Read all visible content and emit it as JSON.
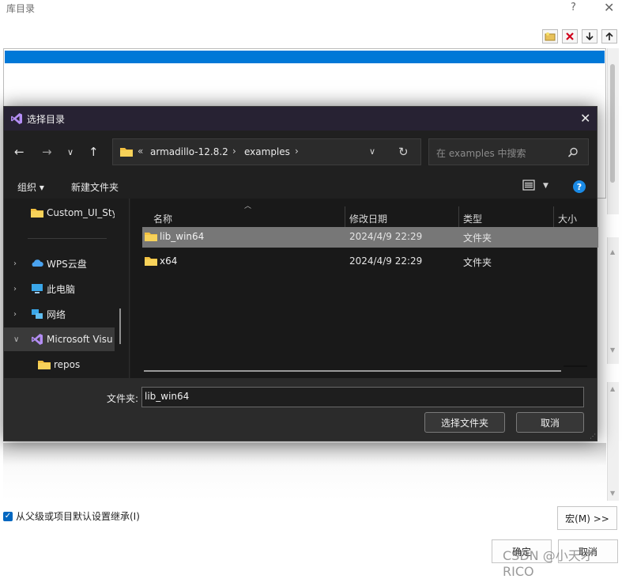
{
  "background_window": {
    "title": "库目录",
    "help": "?",
    "close": "✕",
    "inherit_label": "从父级或项目默认设置继承(I)",
    "macro_button": "宏(M) >>",
    "ok_button": "确定",
    "cancel_button": "取消",
    "watermark": "CSDN @小天才RICO"
  },
  "dialog": {
    "title": "选择目录",
    "close": "✕",
    "breadcrumb": {
      "overflow": "«",
      "parts": [
        "armadillo-12.8.2",
        "examples"
      ]
    },
    "search_placeholder": "在 examples 中搜索",
    "toolbar": {
      "organize": "组织 ▾",
      "new_folder": "新建文件夹",
      "help": "?"
    },
    "nav": [
      {
        "label": "Custom_UI_Sty",
        "icon": "folder-icon",
        "expandable": false
      },
      {
        "label": "WPS云盘",
        "icon": "cloud-icon",
        "expandable": true
      },
      {
        "label": "此电脑",
        "icon": "computer-icon",
        "expandable": true
      },
      {
        "label": "网络",
        "icon": "network-icon",
        "expandable": true
      },
      {
        "label": "Microsoft Visu",
        "icon": "visual-studio-icon",
        "expandable": true,
        "expanded": true,
        "selected": true
      },
      {
        "label": "repos",
        "icon": "folder-icon",
        "expandable": false
      }
    ],
    "columns": {
      "name": "名称",
      "date": "修改日期",
      "type": "类型",
      "size": "大小"
    },
    "files": [
      {
        "name": "lib_win64",
        "date": "2024/4/9 22:29",
        "type": "文件夹",
        "selected": true
      },
      {
        "name": "x64",
        "date": "2024/4/9 22:29",
        "type": "文件夹",
        "selected": false
      }
    ],
    "folder_label": "文件夹:",
    "folder_value": "lib_win64",
    "select_button": "选择文件夹",
    "cancel_button": "取消"
  },
  "colors": {
    "dialog_bg": "#202020",
    "title_bg": "#272233",
    "selection": "#777777",
    "accent": "#0078d7",
    "help_blue": "#1a8ae6"
  }
}
